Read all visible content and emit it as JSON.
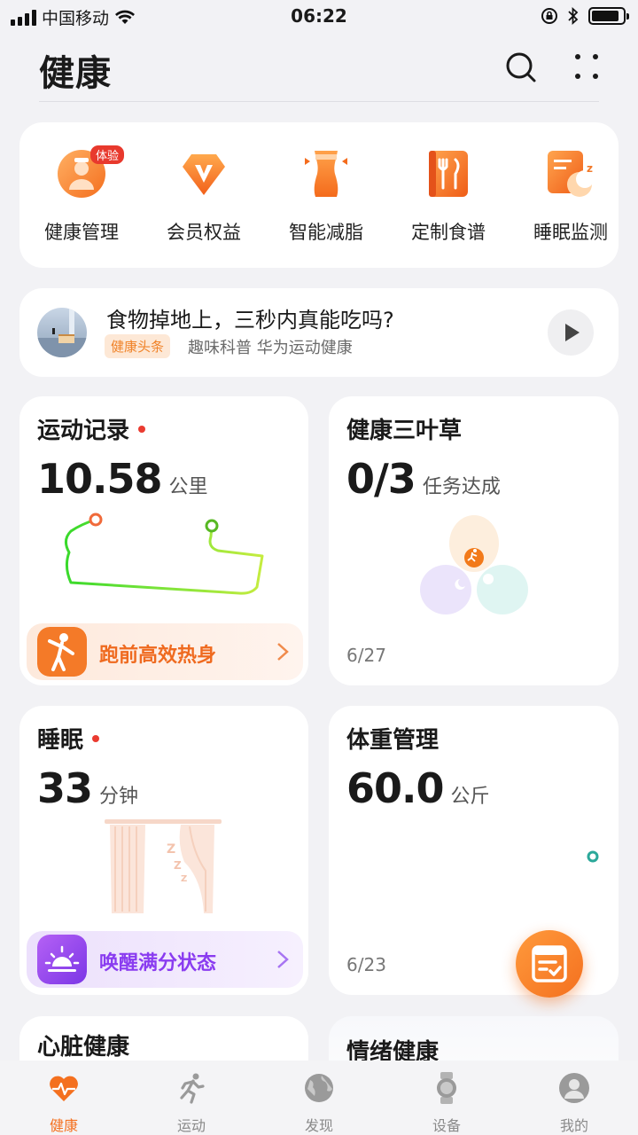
{
  "status_bar": {
    "carrier": "中国移动",
    "time": "06:22"
  },
  "header": {
    "title": "健康"
  },
  "quick_entries": [
    {
      "label": "健康管理",
      "badge": "体验",
      "icon": "health-management-icon"
    },
    {
      "label": "会员权益",
      "icon": "vip-benefits-icon"
    },
    {
      "label": "智能减脂",
      "icon": "fat-loss-icon"
    },
    {
      "label": "定制食谱",
      "icon": "recipe-icon"
    },
    {
      "label": "睡眠监测",
      "icon": "sleep-monitor-icon"
    }
  ],
  "news": {
    "title": "食物掉地上，三秒内真能吃吗?",
    "tag": "健康头条",
    "source": "趣味科普 华为运动健康"
  },
  "exercise": {
    "title": "运动记录",
    "value": "10.58",
    "unit": "公里",
    "action": "跑前高效热身"
  },
  "clover": {
    "title": "健康三叶草",
    "value": "0/3",
    "unit": "任务达成",
    "date": "6/27"
  },
  "sleep": {
    "title": "睡眠",
    "value": "33",
    "unit": "分钟",
    "action": "唤醒满分状态"
  },
  "weight": {
    "title": "体重管理",
    "value": "60.0",
    "unit": "公斤",
    "date": "6/23"
  },
  "heart": {
    "title": "心脏健康"
  },
  "mood": {
    "title": "情绪健康"
  },
  "bottom_nav": [
    {
      "label": "健康",
      "icon": "heart-pulse-icon",
      "active": true
    },
    {
      "label": "运动",
      "icon": "running-icon"
    },
    {
      "label": "发现",
      "icon": "discover-globe-icon"
    },
    {
      "label": "设备",
      "icon": "watch-icon"
    },
    {
      "label": "我的",
      "icon": "profile-icon"
    }
  ],
  "colors": {
    "accent": "#f4701f",
    "red_dot": "#ea3b30",
    "purple": "#8a3cf0"
  }
}
